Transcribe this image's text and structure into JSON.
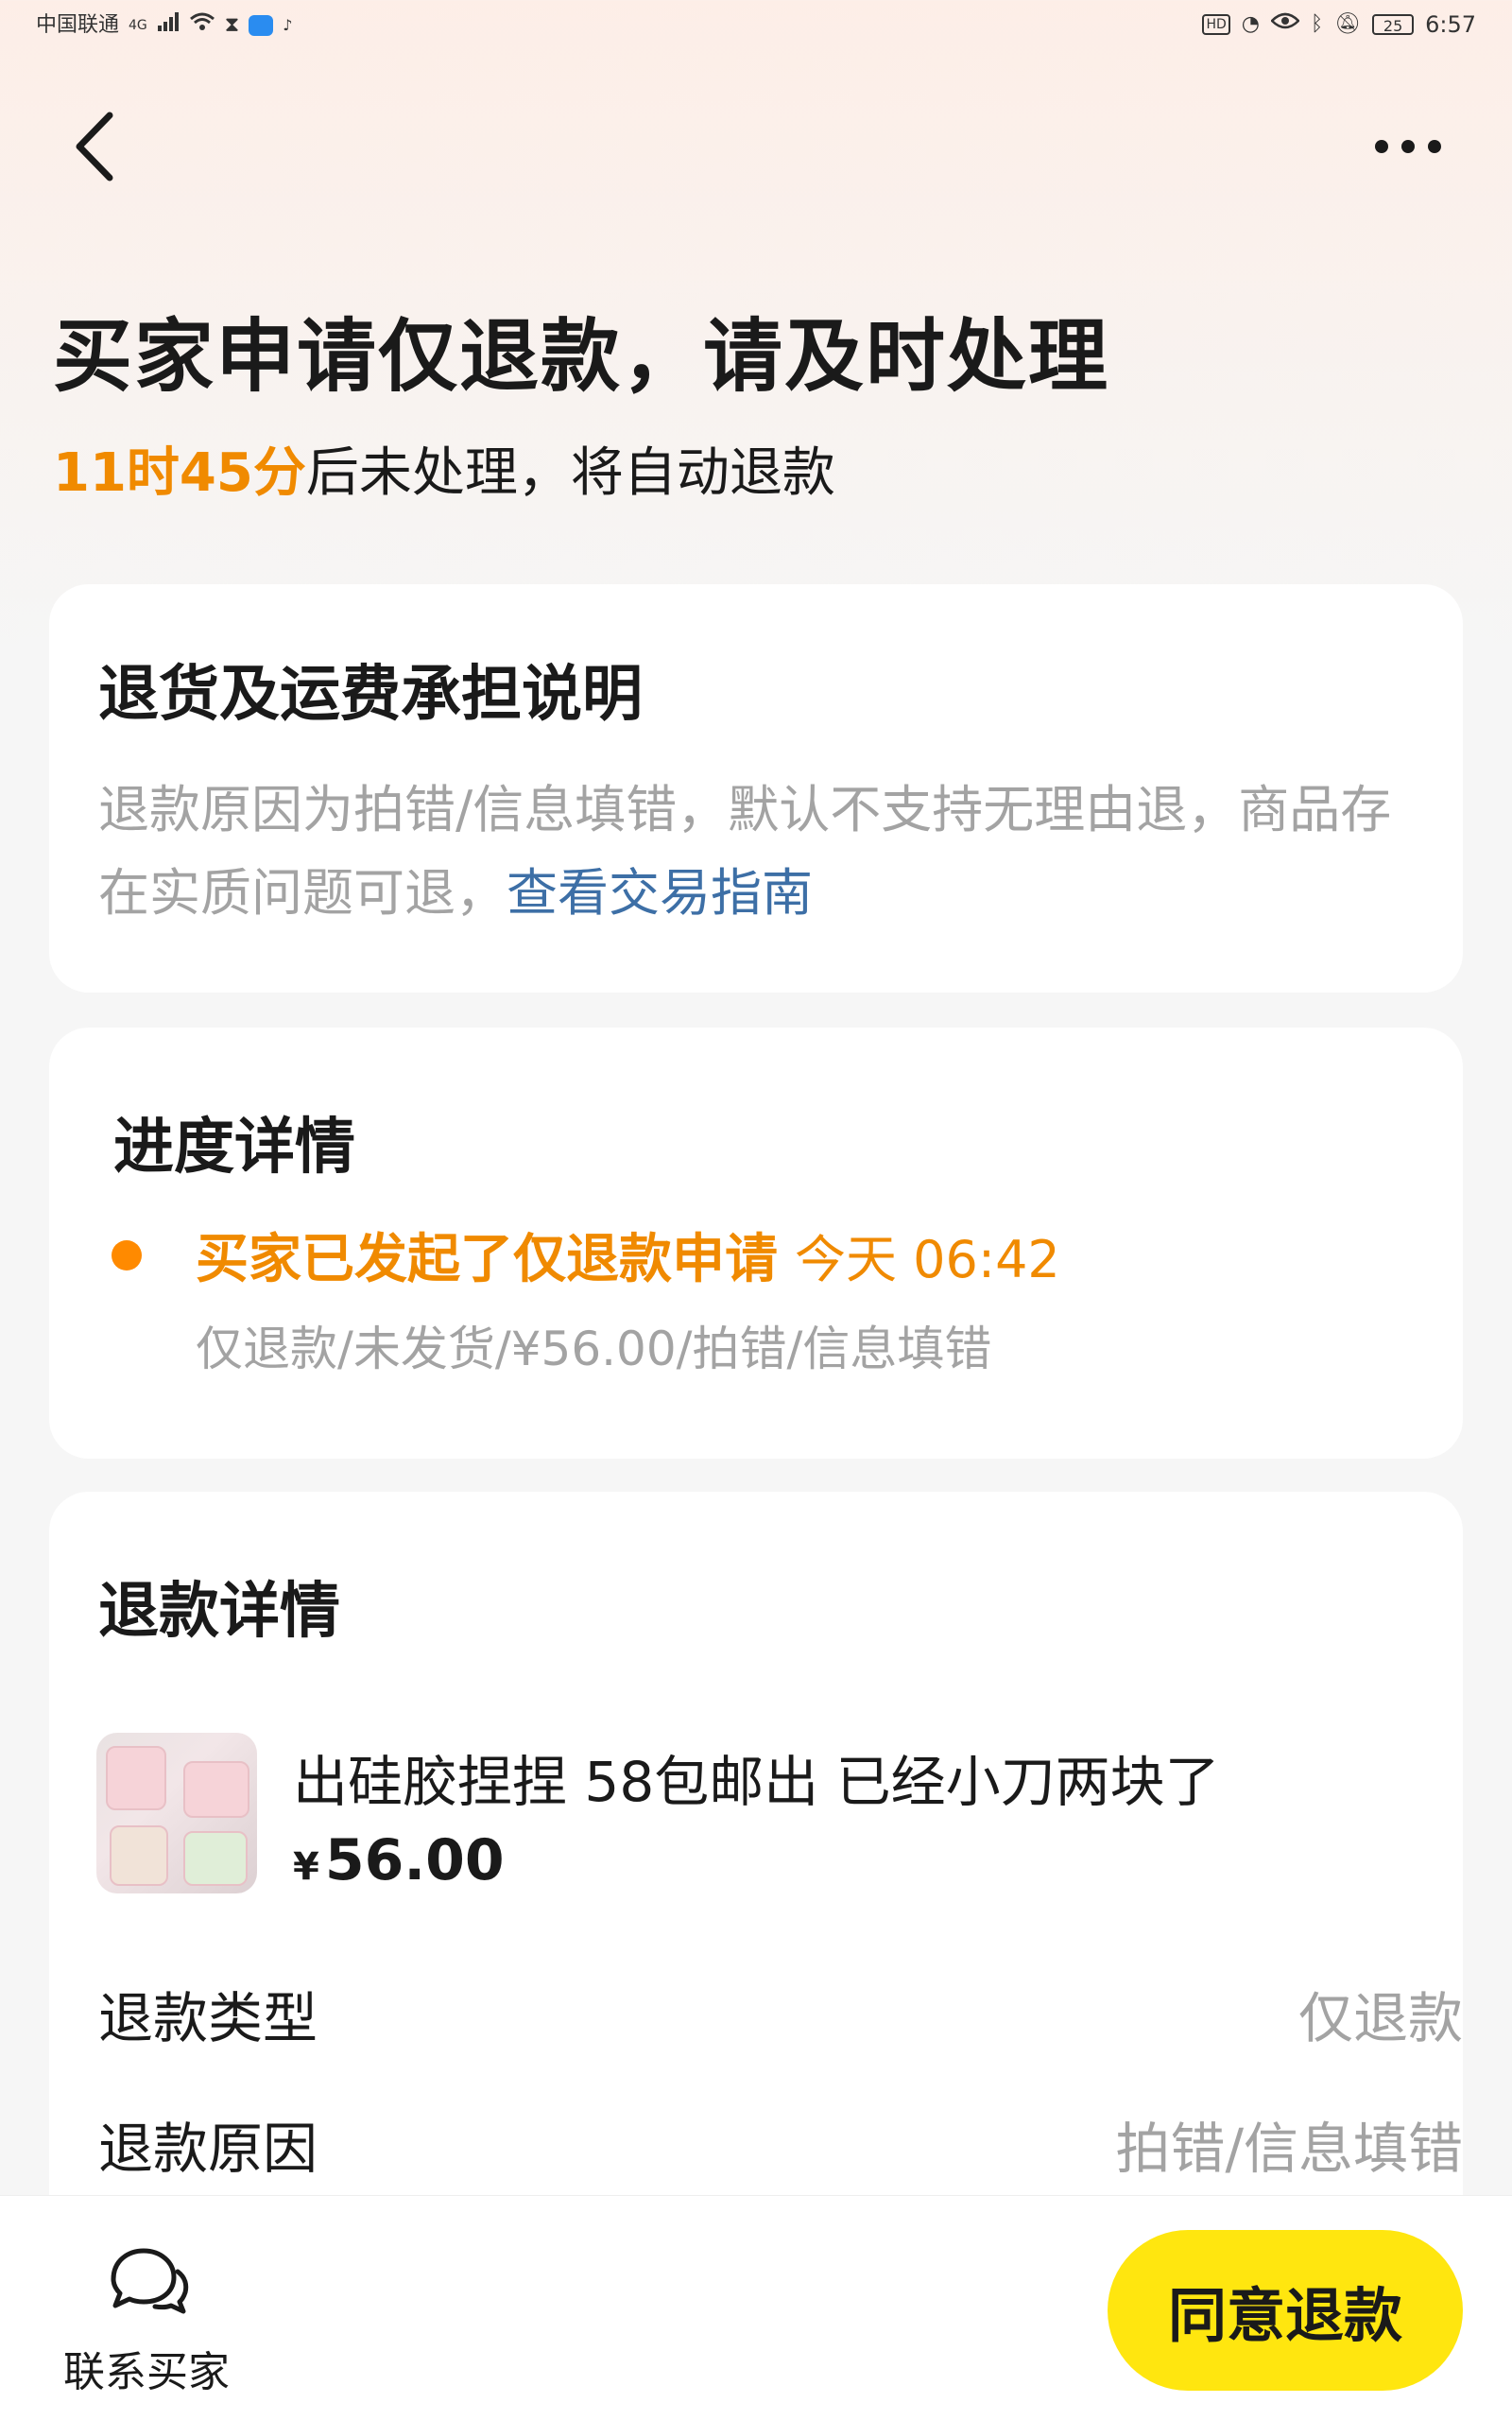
{
  "status_bar": {
    "carrier": "中国联通",
    "network": "4G",
    "time": "6:57",
    "battery": "25",
    "hd": "HD"
  },
  "page": {
    "title": "买家申请仅退款，请及时处理",
    "countdown_highlight": "11时45分",
    "countdown_suffix": "后未处理，将自动退款"
  },
  "return_card": {
    "title": "退货及运费承担说明",
    "description": "退款原因为拍错/信息填错，默认不支持无理由退，商品存在实质问题可退，",
    "link": "查看交易指南"
  },
  "progress_card": {
    "title": "进度详情",
    "status": "买家已发起了仅退款申请",
    "time": "今天 06:42",
    "detail": "仅退款/未发货/¥56.00/拍错/信息填错"
  },
  "refund_card": {
    "title": "退款详情",
    "product_name": "出硅胶捏捏 58包邮出 已经小刀两块了",
    "price_symbol": "¥",
    "price_value": "56.00",
    "rows": [
      {
        "label": "退款类型",
        "value": "仅退款"
      },
      {
        "label": "退款原因",
        "value": "拍错/信息填错"
      }
    ]
  },
  "bottom_bar": {
    "contact_label": "联系买家",
    "agree_label": "同意退款"
  },
  "colors": {
    "accent_orange": "#f08a00",
    "link_blue": "#3d6fa6",
    "button_yellow": "#ffe60f"
  }
}
